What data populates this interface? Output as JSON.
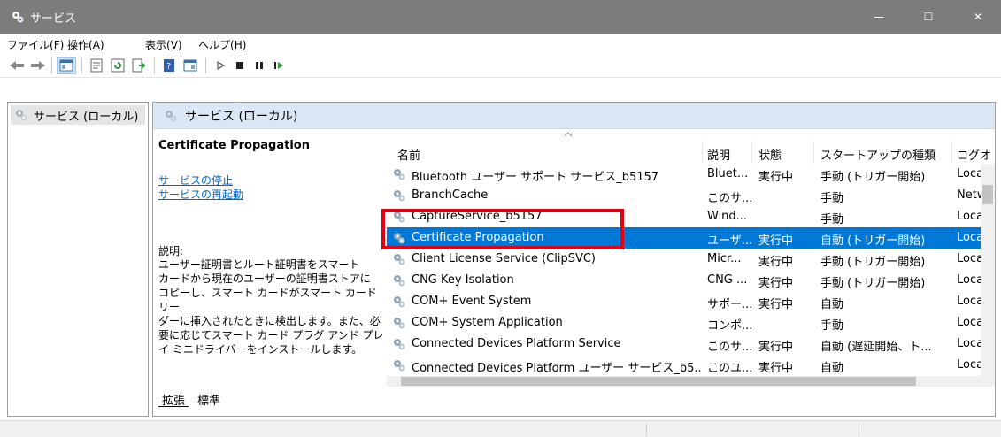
{
  "window": {
    "title": "サービス",
    "minimize": "—",
    "maximize": "☐",
    "close": "✕"
  },
  "menu": [
    {
      "label": "ファイル(",
      "key": "F",
      "suffix": ")"
    },
    {
      "label": "操作(",
      "key": "A",
      "suffix": ")"
    },
    {
      "label": "表示(",
      "key": "V",
      "suffix": ")"
    },
    {
      "label": "ヘルプ(",
      "key": "H",
      "suffix": ")"
    }
  ],
  "tree": {
    "item_label": "サービス (ローカル)"
  },
  "pane": {
    "header": "サービス (ローカル)"
  },
  "details": {
    "title": "Certificate Propagation",
    "stop_link": "サービスの停止",
    "restart_link": "サービスの再起動",
    "desc_label": "説明:",
    "desc_text": "ユーザー証明書とルート証明書をスマート\nカードから現在のユーザーの証明書ストアに\nコピーし、スマート カードがスマート カード リー\nダーに挿入されたときに検出します。また、必\n要に応じてスマート カード プラグ アンド プレ\nイ ミニドライバーをインストールします。"
  },
  "columns": [
    "名前",
    "説明",
    "状態",
    "スタートアップの種類",
    "ログオ"
  ],
  "services": [
    {
      "name": "Bluetooth ユーザー サポート サービス_b5157",
      "desc": "Bluet...",
      "status": "実行中",
      "startup": "手動 (トリガー開始)",
      "logon": "Local"
    },
    {
      "name": "BranchCache",
      "desc": "このサ...",
      "status": "",
      "startup": "手動",
      "logon": "Netw"
    },
    {
      "name": "CaptureService_b5157",
      "desc": "Wind...",
      "status": "",
      "startup": "手動",
      "logon": "Local"
    },
    {
      "name": "Certificate Propagation",
      "desc": "ユーザ...",
      "status": "実行中",
      "startup": "自動 (トリガー開始)",
      "logon": "Local"
    },
    {
      "name": "Client License Service (ClipSVC)",
      "desc": "Micr...",
      "status": "実行中",
      "startup": "手動 (トリガー開始)",
      "logon": "Local"
    },
    {
      "name": "CNG Key Isolation",
      "desc": "CNG ...",
      "status": "実行中",
      "startup": "手動 (トリガー開始)",
      "logon": "Local"
    },
    {
      "name": "COM+ Event System",
      "desc": "サポー...",
      "status": "実行中",
      "startup": "自動",
      "logon": "Local"
    },
    {
      "name": "COM+ System Application",
      "desc": "コンポ...",
      "status": "",
      "startup": "手動",
      "logon": "Local"
    },
    {
      "name": "Connected Devices Platform Service",
      "desc": "このサ...",
      "status": "実行中",
      "startup": "自動 (遅延開始、ト...",
      "logon": "Local"
    },
    {
      "name": "Connected Devices Platform ユーザー サービス_b5...",
      "desc": "このユ...",
      "status": "実行中",
      "startup": "自動",
      "logon": "Local"
    }
  ],
  "selected_index": 3,
  "tabs": [
    "拡張",
    "標準"
  ],
  "colors": {
    "titlebar": "#7c7c7c",
    "selection": "#0078d7",
    "highlight_box": "#e60012",
    "link": "#0066cc"
  }
}
